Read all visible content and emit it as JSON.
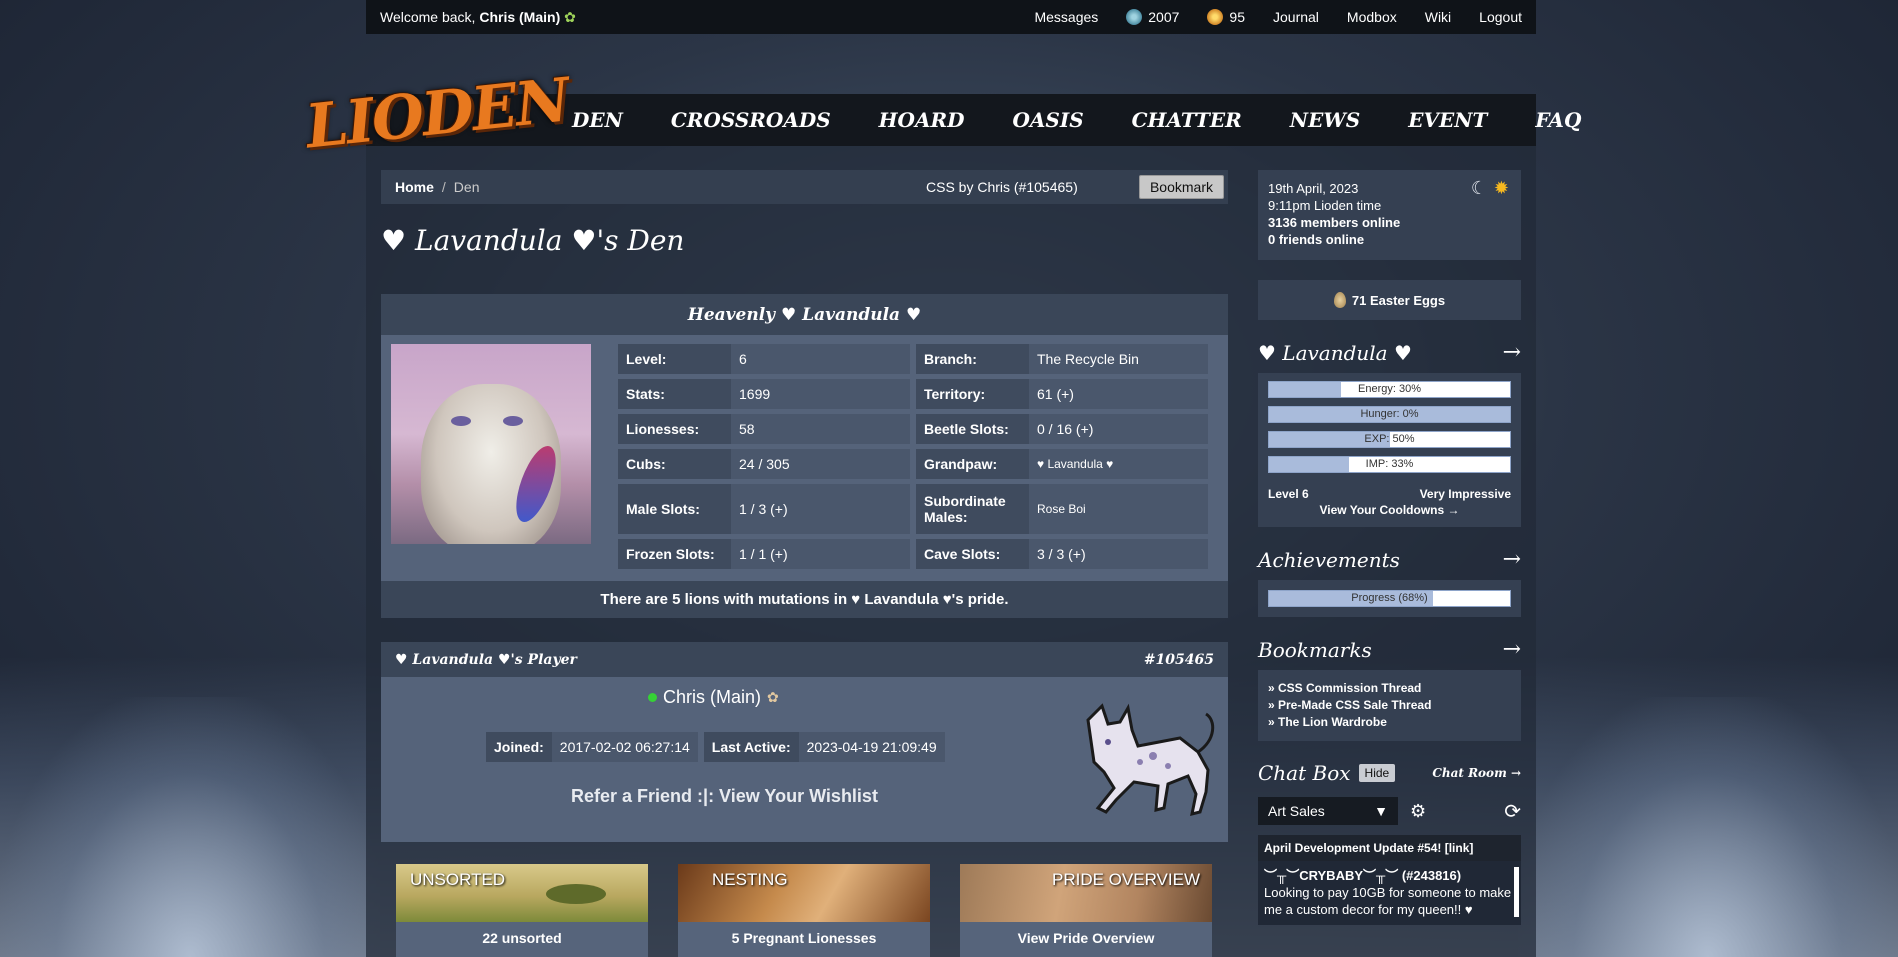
{
  "topbar": {
    "welcome_prefix": "Welcome back,",
    "user": "Chris (Main)",
    "links": {
      "messages": "Messages",
      "silver": "2007",
      "gold": "95",
      "journal": "Journal",
      "modbox": "Modbox",
      "wiki": "Wiki",
      "logout": "Logout"
    }
  },
  "logo": "LIODEN",
  "nav": [
    "DEN",
    "CROSSROADS",
    "HOARD",
    "OASIS",
    "CHATTER",
    "NEWS",
    "EVENT",
    "FAQ"
  ],
  "breadcrumb": {
    "home": "Home",
    "sep": "/",
    "current": "Den",
    "css": "CSS by Chris (#105465)",
    "bookmark": "Bookmark"
  },
  "den_title": "♥ Lavandula ♥'s Den",
  "lion": {
    "title": "Heavenly ♥ Lavandula ♥",
    "stats": [
      [
        {
          "l": "Level:",
          "v": "6"
        },
        {
          "l": "Branch:",
          "v": "The Recycle Bin"
        }
      ],
      [
        {
          "l": "Stats:",
          "v": "1699"
        },
        {
          "l": "Territory:",
          "v": "61 (+)"
        }
      ],
      [
        {
          "l": "Lionesses:",
          "v": "58"
        },
        {
          "l": "Beetle Slots:",
          "v": "0 / 16 (+)"
        }
      ],
      [
        {
          "l": "Cubs:",
          "v": "24 / 305"
        },
        {
          "l": "Grandpaw:",
          "v": "♥ Lavandula ♥"
        }
      ],
      [
        {
          "l": "Male Slots:",
          "v": "1 / 3 (+)"
        },
        {
          "l": "Subordinate Males:",
          "v": "Rose Boi"
        }
      ],
      [
        {
          "l": "Frozen Slots:",
          "v": "1 / 1 (+)"
        },
        {
          "l": "Cave Slots:",
          "v": "3 / 3 (+)"
        }
      ]
    ],
    "mutations": "There are 5 lions with mutations in ♥ Lavandula ♥'s pride."
  },
  "player": {
    "title": "♥ Lavandula ♥'s Player",
    "id": "#105465",
    "name": "Chris (Main)",
    "joined_label": "Joined:",
    "joined": "2017-02-02 06:27:14",
    "active_label": "Last Active:",
    "active": "2023-04-19 21:09:49",
    "refer": "Refer a Friend :|: View Your Wishlist"
  },
  "tiles": [
    {
      "title": "UNSORTED",
      "caption": "22 unsorted"
    },
    {
      "title": "NESTING",
      "caption": "5 Pregnant Lionesses"
    },
    {
      "title": "PRIDE OVERVIEW",
      "caption": "View Pride Overview"
    }
  ],
  "sidebar": {
    "date": "19th April, 2023",
    "time": "9:11pm Lioden time",
    "members": "3136 members online",
    "friends": "0 friends online",
    "eggs": "71 Easter Eggs",
    "lion_name": "♥ Lavandula ♥",
    "bars": [
      {
        "label": "Energy: 30%",
        "pct": 30
      },
      {
        "label": "Hunger: 0%",
        "pct": 100
      },
      {
        "label": "EXP: 50%",
        "pct": 50
      },
      {
        "label": "IMP: 33%",
        "pct": 33
      }
    ],
    "level": "Level 6",
    "impress": "Very Impressive",
    "cooldowns": "View Your Cooldowns →",
    "achievements": "Achievements",
    "progress": {
      "label": "Progress (68%)",
      "pct": 68
    },
    "bookmarks": "Bookmarks",
    "bookmark_items": [
      "» CSS Commission Thread",
      "» Pre-Made CSS Sale Thread",
      "» The Lion Wardrobe"
    ],
    "chat_title": "Chat Box",
    "hide": "Hide",
    "chat_room": "Chat Room →",
    "room": "Art Sales",
    "announcement": "April Development Update #54! [link]",
    "msg_user": "︶╥︶CRYBABY︶╥︶ (#243816)",
    "msg_text": "Looking to pay 10GB for someone to make me a custom decor for my queen!! ♥"
  }
}
